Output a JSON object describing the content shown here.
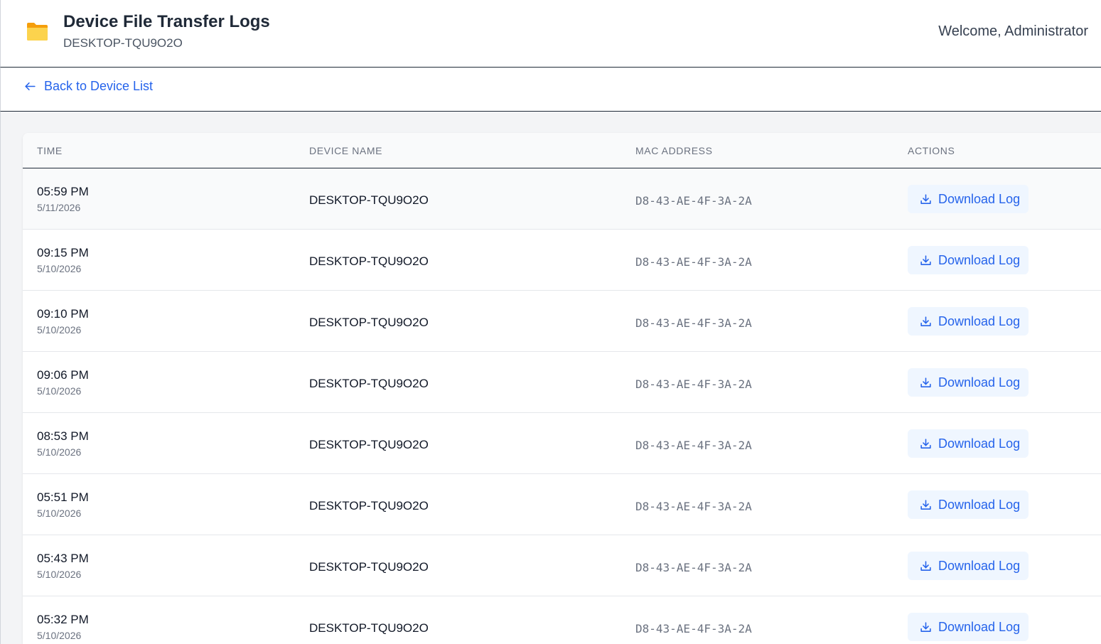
{
  "header": {
    "title": "Device File Transfer Logs",
    "subtitle": "DESKTOP-TQU9O2O",
    "welcome": "Welcome, Administrator"
  },
  "nav": {
    "back_label": "Back to Device List"
  },
  "table": {
    "columns": [
      "TIME",
      "DEVICE NAME",
      "MAC ADDRESS",
      "ACTIONS"
    ],
    "action_label": "Download Log",
    "rows": [
      {
        "time": "05:59 PM",
        "date": "5/11/2026",
        "device": "DESKTOP-TQU9O2O",
        "mac": "D8-43-AE-4F-3A-2A"
      },
      {
        "time": "09:15 PM",
        "date": "5/10/2026",
        "device": "DESKTOP-TQU9O2O",
        "mac": "D8-43-AE-4F-3A-2A"
      },
      {
        "time": "09:10 PM",
        "date": "5/10/2026",
        "device": "DESKTOP-TQU9O2O",
        "mac": "D8-43-AE-4F-3A-2A"
      },
      {
        "time": "09:06 PM",
        "date": "5/10/2026",
        "device": "DESKTOP-TQU9O2O",
        "mac": "D8-43-AE-4F-3A-2A"
      },
      {
        "time": "08:53 PM",
        "date": "5/10/2026",
        "device": "DESKTOP-TQU9O2O",
        "mac": "D8-43-AE-4F-3A-2A"
      },
      {
        "time": "05:51 PM",
        "date": "5/10/2026",
        "device": "DESKTOP-TQU9O2O",
        "mac": "D8-43-AE-4F-3A-2A"
      },
      {
        "time": "05:43 PM",
        "date": "5/10/2026",
        "device": "DESKTOP-TQU9O2O",
        "mac": "D8-43-AE-4F-3A-2A"
      },
      {
        "time": "05:32 PM",
        "date": "5/10/2026",
        "device": "DESKTOP-TQU9O2O",
        "mac": "D8-43-AE-4F-3A-2A"
      }
    ]
  },
  "icons": {
    "header": "folder-icon",
    "back": "arrow-left-icon",
    "action": "download-icon"
  },
  "colors": {
    "accent": "#2563eb",
    "folder": "#fbbf24",
    "button_bg": "#eff6ff"
  }
}
